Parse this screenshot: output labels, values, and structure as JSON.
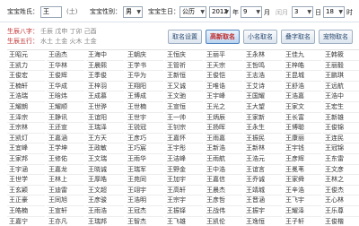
{
  "form": {
    "surname_label": "宝宝姓氏：",
    "surname_value": "王",
    "surname_hint": "(土)",
    "gender_label": "宝宝性别：",
    "gender_value": "男",
    "birth_label": "宝宝生日：",
    "calendar_value": "公历",
    "year_value": "2012",
    "year_unit": "年",
    "month_value": "9",
    "month_unit": "月",
    "leap_label": "闰月",
    "day_value": "3",
    "day_unit": "日",
    "hour_value": "18",
    "hour_unit": "时"
  },
  "info": {
    "bazi_label": "生辰八字：",
    "bazi_value": "壬辰 戊申 丁卯 己酉",
    "wuxing_label": "生辰五行：",
    "wuxing_value": "水土 土金 火木 土金"
  },
  "buttons": [
    {
      "label": "取名设置",
      "active": false
    },
    {
      "label": "高新取名",
      "active": true
    },
    {
      "label": "小名取名",
      "active": false
    },
    {
      "label": "叠字取名",
      "active": false
    },
    {
      "label": "宠物取名",
      "active": false
    }
  ],
  "colors": {
    "accent_red": "#c03030",
    "link_blue": "#2a4a70"
  },
  "names": [
    [
      "王昭元",
      "王函杰",
      "王海中",
      "王朝庆",
      "王恒庆",
      "王丽平",
      "王永林",
      "王佳九",
      "王韩筱"
    ],
    [
      "王凯力",
      "王华林",
      "王晨熙",
      "王学书",
      "王管祈",
      "王天宗",
      "王哲鸣",
      "王梓皓",
      "王丽毅"
    ],
    [
      "王俊宏",
      "王俊辉",
      "王季俊",
      "王华为",
      "王新恒",
      "王俊恺",
      "王志浩",
      "王昆城",
      "王鹏琪"
    ],
    [
      "王楠轩",
      "王华成",
      "王梓羽",
      "王翔阳",
      "王又诚",
      "王唯诰",
      "王艾诗",
      "王舒浩",
      "王远航"
    ],
    [
      "王浩瑞",
      "王晗炜",
      "王成慕",
      "王博成",
      "王文驰",
      "王宇峰",
      "王国耀",
      "王浩嘉",
      "王浩中"
    ],
    [
      "王耀朗",
      "王耀顺",
      "王世骅",
      "王世楠",
      "王宣恒",
      "王光之",
      "王大望",
      "王家文",
      "王宏生"
    ],
    [
      "王泽宗",
      "王静讯",
      "王谊阳",
      "王世宇",
      "王一帅",
      "王炳辰",
      "王家新",
      "王长富",
      "王新雄"
    ],
    [
      "王宗林",
      "王还宣",
      "王瑞泽",
      "王锐冠",
      "王钊宗",
      "王扬晖",
      "王永生",
      "王博聪",
      "王俊锦"
    ],
    [
      "王凯灯",
      "王嘉涵",
      "王方天",
      "王彦巧",
      "王嘉怀",
      "王雨嘉",
      "王振民",
      "王康丽",
      "王连民"
    ],
    [
      "王宜峰",
      "王学坤",
      "王政敏",
      "王巧宸",
      "王宇彤",
      "王新浩",
      "王新林",
      "王宇钱",
      "王冠锦"
    ],
    [
      "王家邦",
      "王修佑",
      "王文瑞",
      "王雨华",
      "王洁峰",
      "王雨航",
      "王浩元",
      "王彦辉",
      "王东雷"
    ],
    [
      "王宇涵",
      "王嘉龙",
      "王晓诚",
      "王瑞军",
      "王野金",
      "王中浩",
      "王谊言",
      "王冕苇",
      "王文彦"
    ],
    [
      "王世学",
      "王林上",
      "王厚皓",
      "王苑同",
      "王加宇",
      "王嘉信",
      "王乔诚",
      "王家舜",
      "王林之"
    ],
    [
      "王玄颖",
      "王迪雷",
      "王文超",
      "王翊宇",
      "王高轩",
      "王晨杰",
      "王靖城",
      "王辛浩",
      "王俊杰"
    ],
    [
      "王正豪",
      "王同旭",
      "王彦骏",
      "王浩明",
      "王宗宇",
      "王彦哲",
      "王晋涵",
      "王飞宇",
      "王心林"
    ],
    [
      "王皓楠",
      "王宣轩",
      "王雨浩",
      "王冠杰",
      "王振铎",
      "王战伟",
      "王振宇",
      "王耀泽",
      "王乐尊"
    ],
    [
      "王嘉宁",
      "王亦凡",
      "王瑞邦",
      "王智杰",
      "王飞雄",
      "王凯伦",
      "王逸恒",
      "王子轩",
      "王俊楷"
    ]
  ]
}
